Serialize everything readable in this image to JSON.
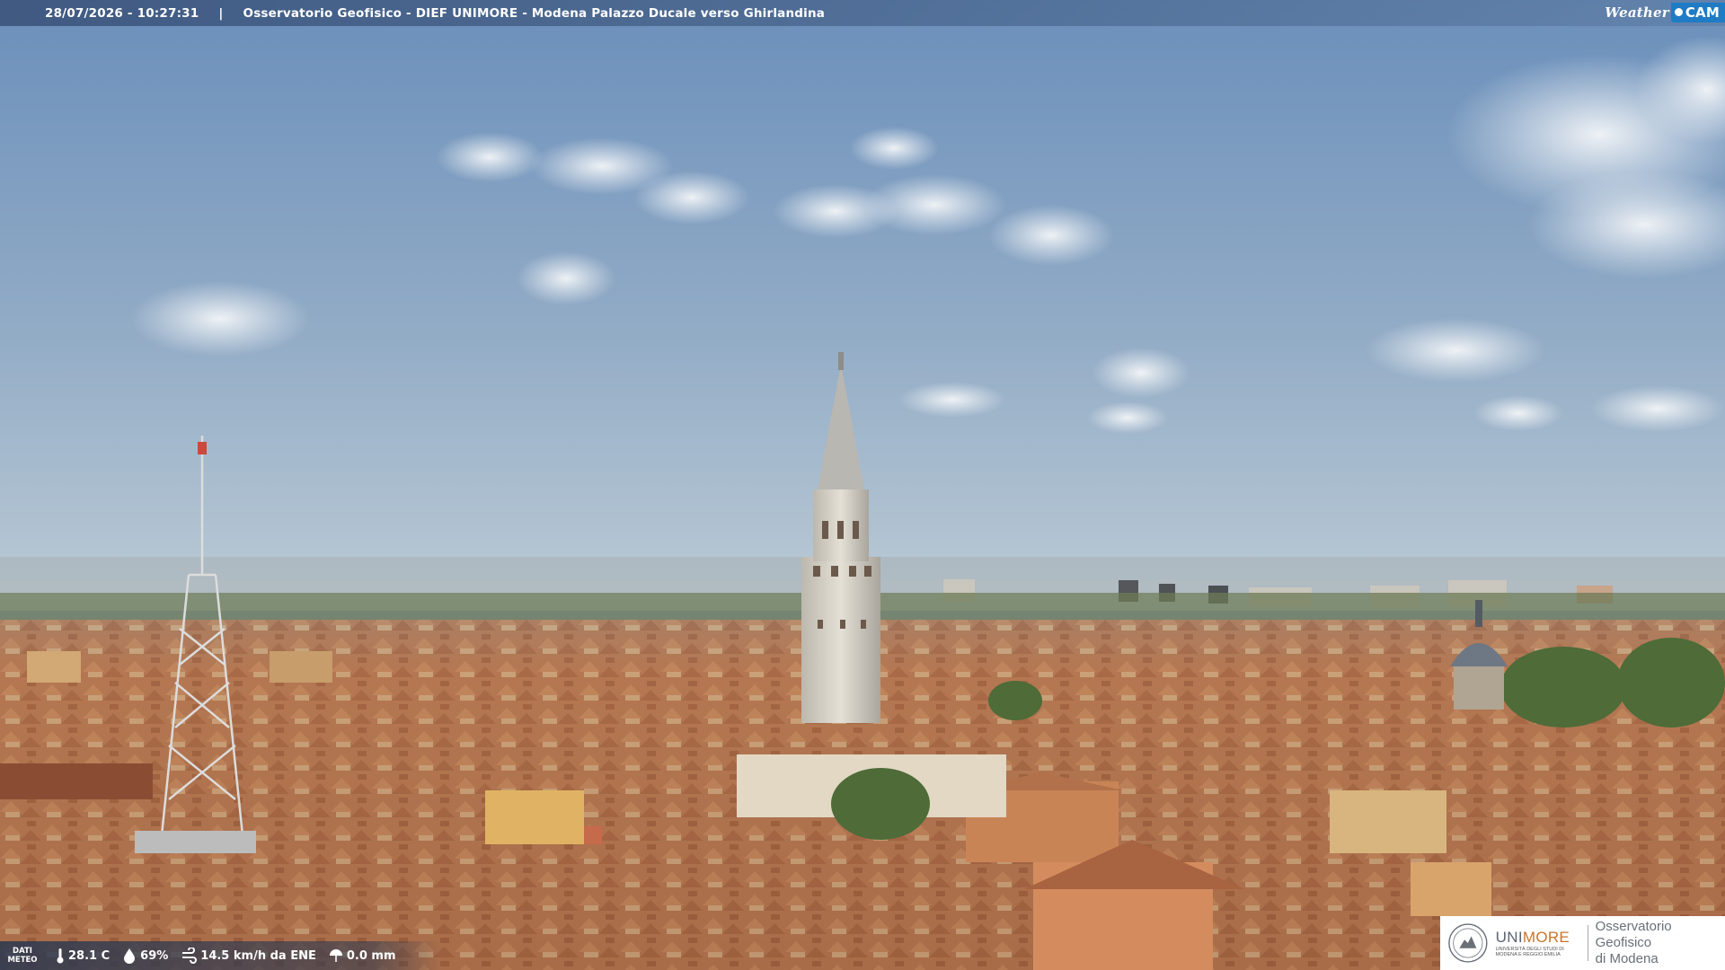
{
  "overlay": {
    "timestamp": "28/07/2026 - 10:27:31",
    "separator": "|",
    "camera_title": "Osservatorio Geofisico - DIEF UNIMORE - Modena Palazzo Ducale verso Ghirlandina",
    "brand_weather": "Weather",
    "brand_cam": "CAM"
  },
  "weather": {
    "label_line1": "DATI",
    "label_line2": "METEO",
    "temperature": "28.1 C",
    "humidity": "69%",
    "wind": "14.5 km/h da ENE",
    "rain": "0.0 mm"
  },
  "logo": {
    "uni_part1": "UNI",
    "uni_part2": "MORE",
    "uni_sub": "UNIVERSITÀ DEGLI STUDI DI MODENA E REGGIO EMILIA",
    "observatory_line1": "Osservatorio Geofisico",
    "observatory_line2": "di Modena"
  },
  "colors": {
    "sky_top": "#6f93bd",
    "sky_horizon": "#b9c9d6",
    "roof": "#b8784c",
    "tower_stone": "#d9d4c8"
  }
}
